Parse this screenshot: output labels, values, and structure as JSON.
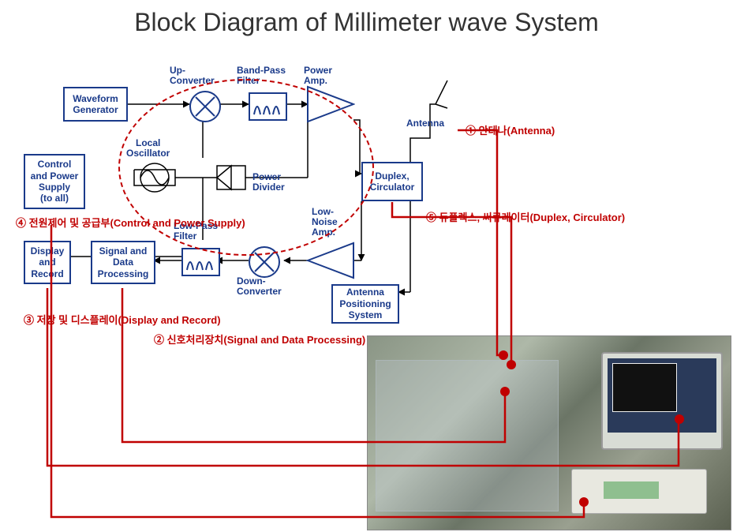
{
  "title": "Block Diagram of Millimeter wave System",
  "blocks": {
    "waveform_generator": "Waveform\nGenerator",
    "control_power": "Control\nand Power\nSupply\n(to all)",
    "display_record": "Display\nand\nRecord",
    "signal_data": "Signal and\nData\nProcessing",
    "duplex_circulator": "Duplex,\nCirculator",
    "antenna_pos": "Antenna\nPositioning\nSystem"
  },
  "labels": {
    "up_converter": "Up-\nConverter",
    "bandpass": "Band-Pass\nFilter",
    "power_amp": "Power\nAmp.",
    "local_osc": "Local\nOscillator",
    "power_divider": "Power\nDivider",
    "lowpass": "Low-Pass\nFilter",
    "low_noise_amp": "Low-\nNoise\nAmp.",
    "down_converter": "Down-\nConverter",
    "antenna": "Antenna"
  },
  "annotations": {
    "a1": "① 안테나(Antenna)",
    "a2": "② 신호처리장치(Signal and Data Processing)",
    "a3": "③ 저장 및 디스플레이(Display and Record)",
    "a4": "④ 전원제어 및 공급부(Control and Power Supply)",
    "a5": "⑤ 듀플렉스, 써큐레이터(Duplex, Circulator)"
  }
}
